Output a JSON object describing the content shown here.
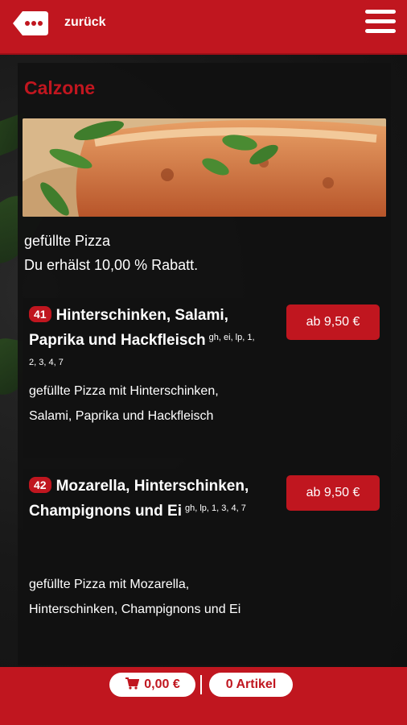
{
  "header": {
    "back_label": "zurück"
  },
  "category": {
    "title": "Calzone",
    "description_line1": "gefüllte Pizza",
    "description_line2": "Du erhälst 10,00 % Rabatt."
  },
  "items": [
    {
      "number": "41",
      "name": "Hinterschinken, Salami, Paprika und Hackfleisch",
      "allergens": "gh, ei, lp, 1, 2, 3, 4, 7",
      "description": "gefüllte Pizza mit Hinterschinken, Salami, Paprika und Hackfleisch",
      "price": "ab 9,50 €"
    },
    {
      "number": "42",
      "name": "Mozarella, Hinterschinken, Champignons und Ei",
      "allergens": "gh, lp, 1, 3, 4, 7",
      "description": "gefüllte Pizza mit Mozarella, Hinterschinken, Champignons und Ei",
      "price": "ab 9,50 €"
    }
  ],
  "footer": {
    "cart_total": "0,00 €",
    "cart_count": "0 Artikel"
  },
  "colors": {
    "brand_red": "#c0161f",
    "panel_bg": "#111111"
  },
  "icons": {
    "back": "dots-back-icon",
    "menu": "hamburger-menu-icon",
    "cart": "shopping-cart-icon"
  }
}
